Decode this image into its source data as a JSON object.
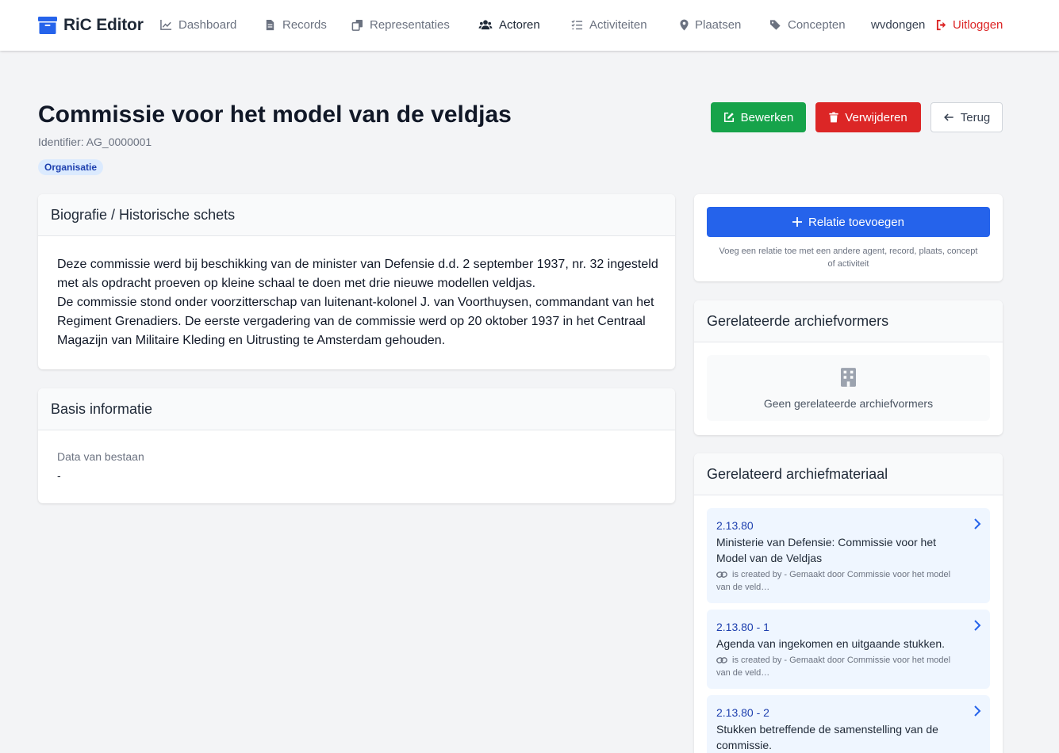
{
  "nav": {
    "brand": "RiC Editor",
    "items": [
      {
        "label": "Dashboard",
        "icon": "chart-line-icon"
      },
      {
        "label": "Records",
        "icon": "file-icon"
      },
      {
        "label": "Representaties",
        "icon": "copy-icon"
      },
      {
        "label": "Actoren",
        "icon": "users-icon",
        "active": true
      },
      {
        "label": "Activiteiten",
        "icon": "list-check-icon"
      },
      {
        "label": "Plaatsen",
        "icon": "map-pin-icon"
      },
      {
        "label": "Concepten",
        "icon": "tags-icon"
      }
    ],
    "user": "wvdongen",
    "logout": "Uitloggen"
  },
  "page": {
    "title": "Commissie voor het model van de veldjas",
    "identifier": "Identifier: AG_0000001",
    "type": "Organisatie"
  },
  "actions": {
    "edit": "Bewerken",
    "delete": "Verwijderen",
    "back": "Terug"
  },
  "bio": {
    "heading": "Biografie / Historische schets",
    "paragraph1": "Deze commissie werd bij beschikking van de minister van Defensie d.d. 2 september 1937, nr. 32 ingesteld met als opdracht proeven op kleine schaal te doen met drie nieuwe modellen veldjas.",
    "paragraph2": "De commissie stond onder voorzitterschap van luitenant-kolonel J. van Voorthuysen, commandant van het Regiment Grenadiers. De eerste vergadering van de commissie werd op 20 oktober 1937 in het Centraal Magazijn van Militaire Kleding en Uitrusting te Amsterdam gehouden."
  },
  "basis": {
    "heading": "Basis informatie",
    "label": "Data van bestaan",
    "value": "-"
  },
  "relations": {
    "add_button": "Relatie toevoegen",
    "help": "Voeg een relatie toe met een andere agent, record, plaats, concept of activiteit"
  },
  "vormers": {
    "heading": "Gerelateerde archiefvormers",
    "empty": "Geen gerelateerde archiefvormers"
  },
  "materiaal": {
    "heading": "Gerelateerd archiefmateriaal",
    "items": [
      {
        "code": "2.13.80",
        "title": "Ministerie van Defensie: Commissie voor het Model van de Veldjas",
        "meta": "is created by - Gemaakt door Commissie voor het model van de veld…"
      },
      {
        "code": "2.13.80 - 1",
        "title": "Agenda van ingekomen en uitgaande stukken.",
        "meta": "is created by - Gemaakt door Commissie voor het model van de veld…"
      },
      {
        "code": "2.13.80 - 2",
        "title": "Stukken betreffende de samenstelling van de commissie.",
        "meta": ""
      }
    ]
  },
  "colors": {
    "primary": "#2563eb",
    "success": "#16a34a",
    "danger": "#dc2626",
    "badge_bg": "#dbeafe",
    "badge_text": "#1e40af"
  }
}
